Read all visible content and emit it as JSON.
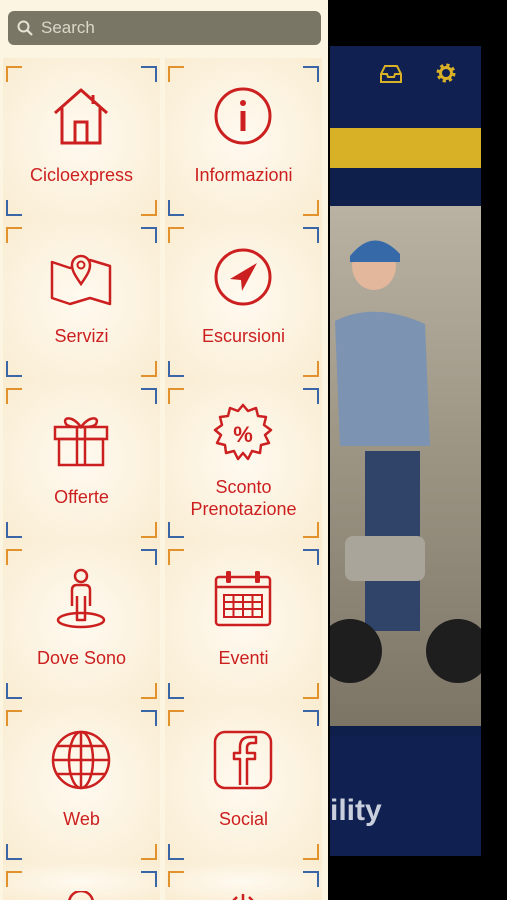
{
  "search": {
    "placeholder": "Search"
  },
  "menu": {
    "items": [
      {
        "label": "Cicloexpress",
        "icon": "home-icon"
      },
      {
        "label": "Informazioni",
        "icon": "info-icon"
      },
      {
        "label": "Servizi",
        "icon": "map-icon"
      },
      {
        "label": "Escursioni",
        "icon": "compass-icon"
      },
      {
        "label": "Offerte",
        "icon": "gift-icon"
      },
      {
        "label": "Sconto\nPrenotazione",
        "icon": "discount-icon"
      },
      {
        "label": "Dove Sono",
        "icon": "location-person-icon"
      },
      {
        "label": "Eventi",
        "icon": "calendar-icon"
      },
      {
        "label": "Web",
        "icon": "globe-icon"
      },
      {
        "label": "Social",
        "icon": "facebook-icon"
      }
    ]
  },
  "background_app": {
    "bottom_text": "ility"
  },
  "colors": {
    "accent": "#cc2020",
    "drawer_bg": "#fbf5e2",
    "corner_orange": "#e2922c",
    "corner_blue": "#3a66a8",
    "app_navy": "#0f2051",
    "app_gold": "#d8b126"
  }
}
